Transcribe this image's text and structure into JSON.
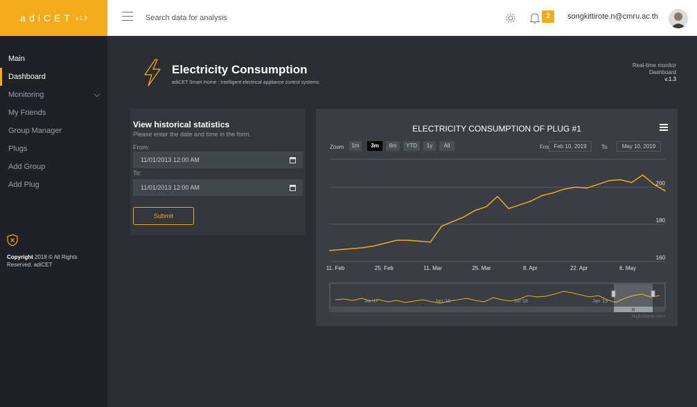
{
  "brand": {
    "name": "adiCET",
    "version": "v.1.3"
  },
  "topbar": {
    "search_placeholder": "Search data for analysis",
    "notification_count": "2",
    "user_email": "songkittirote.n@cmru.ac.th"
  },
  "sidebar": {
    "items": [
      {
        "label": "Main",
        "type": "heading"
      },
      {
        "label": "Dashboard",
        "active": true
      },
      {
        "label": "Monitoring",
        "has_submenu": true
      },
      {
        "label": "My Friends"
      },
      {
        "label": "Group Manager"
      },
      {
        "label": "Plugs"
      },
      {
        "label": "Add Group"
      },
      {
        "label": "Add Plug"
      }
    ],
    "copyright_strong": "Copyright",
    "copyright_rest": " 2018 © All Rights Reserved. adiCET"
  },
  "header": {
    "title": "Electricity Consumption",
    "subtitle": "adiCET Smart Home : Intelligent electrical appliance control systems.",
    "right_line1": "Real-time monitor",
    "right_line2": "Dashboard",
    "right_line3": "v.1.3"
  },
  "history": {
    "title": "View historical statistics",
    "description": "Please enter the date and time in the form.",
    "from_label": "From:",
    "from_value": "11/01/2013 12:00 AM",
    "to_label": "To:",
    "to_value": "11/01/2013 12:00 AM",
    "submit_label": "Submit"
  },
  "chart_controls": {
    "zoom_label": "Zoom",
    "zoom_buttons": [
      "1m",
      "3m",
      "6m",
      "YTD",
      "1y",
      "All"
    ],
    "selected_zoom": "3m",
    "from_label": "From",
    "from_date": "Feb 10, 2019",
    "to_label": "To",
    "to_date": "May 10, 2019",
    "credit": "Highcharts.com"
  },
  "colors": {
    "accent": "#f2ab1a",
    "background": "#2b2d33",
    "sidebar": "#1f2126",
    "panel": "#3a3d44"
  },
  "icons": [
    "menu-icon",
    "gear-icon",
    "bell-icon",
    "calendar-icon",
    "lightning-icon",
    "shield-x-icon",
    "chart-menu-icon"
  ],
  "chart_data": {
    "type": "line",
    "title": "ELECTRICITY CONSUMPTION OF PLUG #1",
    "y_ticks": [
      160,
      180,
      200
    ],
    "ylim": [
      160,
      215
    ],
    "x_ticks": [
      "11. Feb",
      "25. Feb",
      "11. Mar",
      "25. Mar",
      "8. Apr",
      "22. Apr",
      "6. May"
    ],
    "series": [
      {
        "color": "#f2ab1a",
        "x": [
          "Feb 10",
          "Feb 13",
          "Feb 16",
          "Feb 19",
          "Feb 22",
          "Feb 25",
          "Feb 28",
          "Mar 3",
          "Mar 6",
          "Mar 9",
          "Mar 12",
          "Mar 15",
          "Mar 18",
          "Mar 21",
          "Mar 24",
          "Mar 27",
          "Mar 30",
          "Apr 2",
          "Apr 5",
          "Apr 8",
          "Apr 11",
          "Apr 14",
          "Apr 17",
          "Apr 20",
          "Apr 23",
          "Apr 26",
          "Apr 29",
          "May 2",
          "May 5",
          "May 8",
          "May 10"
        ],
        "values": [
          166,
          166.5,
          167,
          167.5,
          168.5,
          170,
          171.5,
          171.5,
          171,
          170.5,
          179,
          181.5,
          184,
          187.5,
          189.5,
          195,
          188.5,
          190.5,
          192.5,
          195.5,
          197,
          199,
          200,
          199.5,
          201.5,
          203.5,
          204,
          202.5,
          206.5,
          201.5,
          198
        ]
      }
    ],
    "navigator": {
      "x_labels": [
        "Jul '17",
        "Jan '18",
        "Jul '18",
        "Jan '19"
      ],
      "scroll_label": "III"
    }
  }
}
